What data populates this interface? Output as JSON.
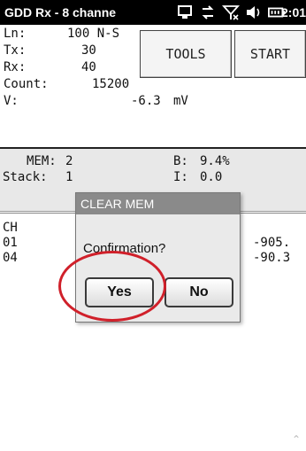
{
  "titlebar": {
    "title": "GDD Rx - 8 channe",
    "time": "2:01",
    "icons": [
      "sync-icon",
      "data-transfer-icon",
      "signal-no-data-icon",
      "volume-icon",
      "battery-icon"
    ]
  },
  "readings": {
    "ln_label": "Ln:",
    "ln_value": "100 N-S",
    "tx_label": "Tx:",
    "tx_value": "30",
    "rx_label": "Rx:",
    "rx_value": "40",
    "count_label": "Count:",
    "count_value": "15200",
    "v_label": "V:",
    "v_value": "-6.3",
    "v_unit": "mV"
  },
  "buttons": {
    "tools": "TOOLS",
    "start": "START"
  },
  "memory": {
    "mem_label": "MEM:",
    "mem_value": "2",
    "stack_label": "Stack:",
    "stack_value": "1",
    "b_label": "B:",
    "b_value": "9.4%",
    "i_label": "I:",
    "i_value": "0.0"
  },
  "channels": {
    "header": "CH",
    "rows": [
      {
        "ch": "01",
        "value": "-905."
      },
      {
        "ch": "04",
        "value": "-90.3"
      }
    ]
  },
  "dialog": {
    "title": "CLEAR MEM",
    "message": "Confirmation?",
    "yes": "Yes",
    "no": "No"
  },
  "colors": {
    "titlebar_bg": "#000000",
    "dialog_title_bg": "#8a8a8a",
    "highlight": "#d0202a"
  }
}
